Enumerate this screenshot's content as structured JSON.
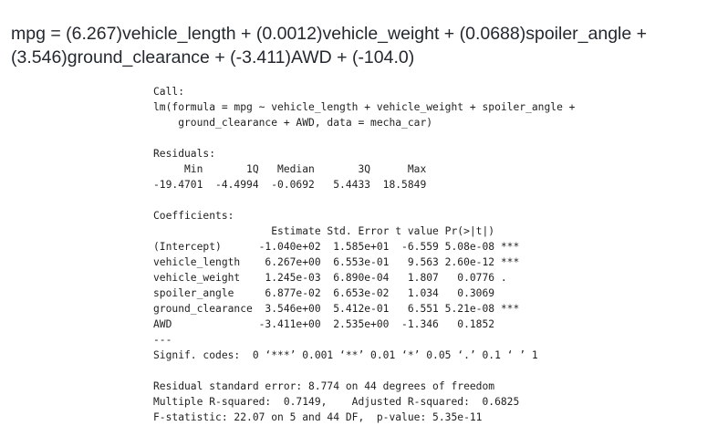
{
  "heading": {
    "line1": "mpg = (6.267)vehicle_length + (0.0012)vehicle_weight + (0.0688)spoiler_angle +",
    "line2": "(3.546)ground_clearance + (-3.411)AWD + (-104.0)"
  },
  "regression_output": {
    "lines": [
      "Call:",
      "lm(formula = mpg ~ vehicle_length + vehicle_weight + spoiler_angle +",
      "    ground_clearance + AWD, data = mecha_car)",
      "",
      "Residuals:",
      "     Min       1Q   Median       3Q      Max",
      "-19.4701  -4.4994  -0.0692   5.4433  18.5849",
      "",
      "Coefficients:",
      "                   Estimate Std. Error t value Pr(>|t|)",
      "(Intercept)      -1.040e+02  1.585e+01  -6.559 5.08e-08 ***",
      "vehicle_length    6.267e+00  6.553e-01   9.563 2.60e-12 ***",
      "vehicle_weight    1.245e-03  6.890e-04   1.807   0.0776 .",
      "spoiler_angle     6.877e-02  6.653e-02   1.034   0.3069",
      "ground_clearance  3.546e+00  5.412e-01   6.551 5.21e-08 ***",
      "AWD              -3.411e+00  2.535e+00  -1.346   0.1852",
      "---",
      "Signif. codes:  0 ‘***’ 0.001 ‘**’ 0.01 ‘*’ 0.05 ‘.’ 0.1 ‘ ’ 1",
      "",
      "Residual standard error: 8.774 on 44 degrees of freedom",
      "Multiple R-squared:  0.7149,    Adjusted R-squared:  0.6825",
      "F-statistic: 22.07 on 5 and 44 DF,  p-value: 5.35e-11"
    ]
  }
}
